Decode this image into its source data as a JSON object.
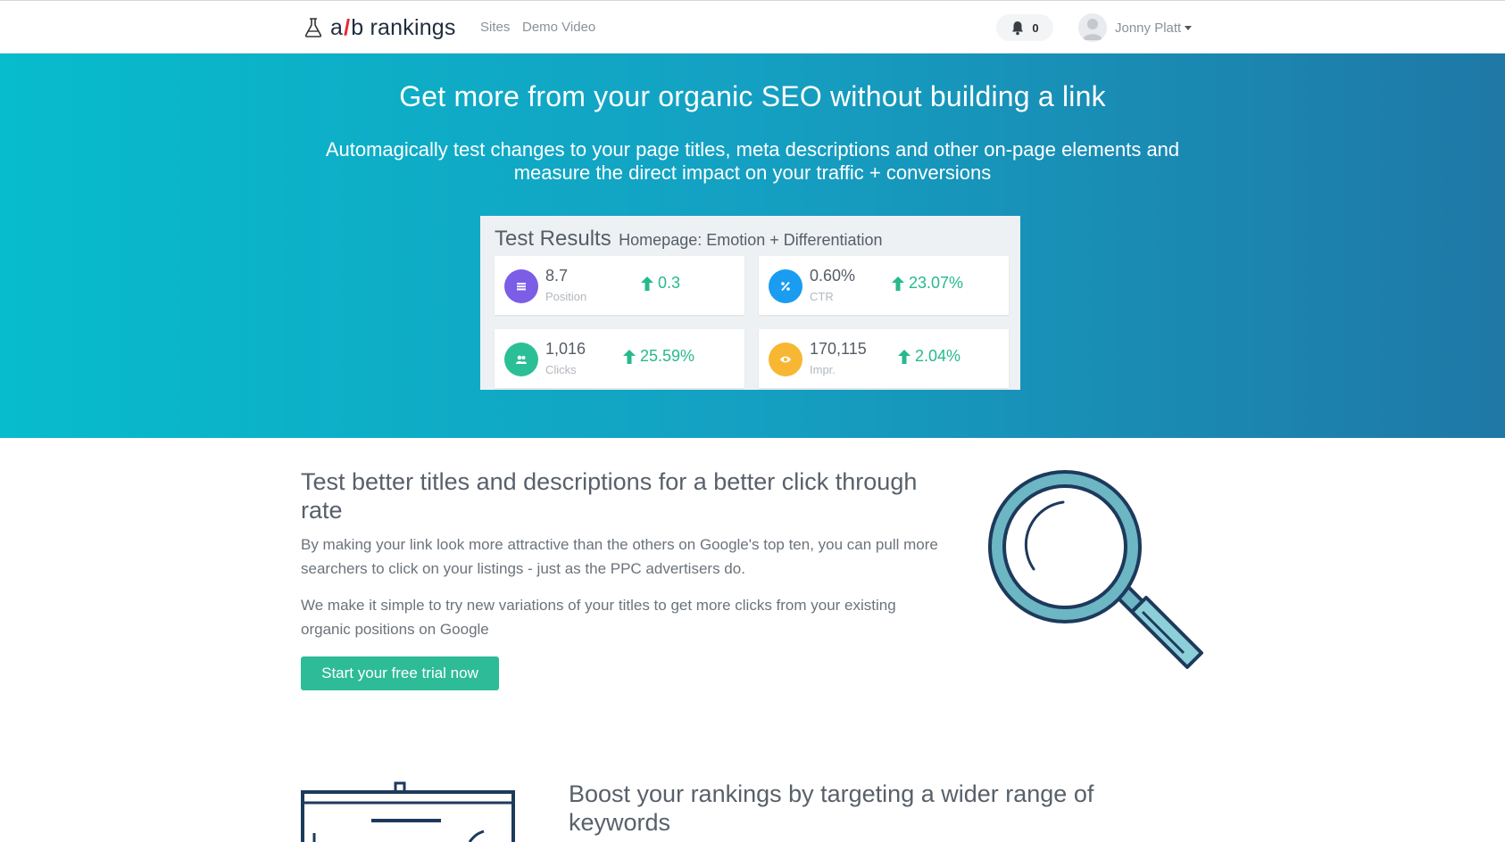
{
  "brand": {
    "prefix": "a",
    "slash": "/",
    "suffix": "b rankings"
  },
  "nav": {
    "sites": "Sites",
    "demo_video": "Demo Video"
  },
  "notifications": {
    "count": "0"
  },
  "user": {
    "name": "Jonny Platt"
  },
  "hero": {
    "title": "Get more from your organic SEO without building a link",
    "subtitle": "Automagically test changes to your page titles, meta descriptions and other on-page elements and measure the direct impact on your traffic + conversions"
  },
  "results": {
    "title": "Test Results",
    "subtitle": "Homepage: Emotion + Differentiation",
    "cards": [
      {
        "value": "8.7",
        "label": "Position",
        "delta": "0.3",
        "icon": "list-icon",
        "color": "#7b5de6"
      },
      {
        "value": "0.60%",
        "label": "CTR",
        "delta": "23.07%",
        "icon": "percent-icon",
        "color": "#1a9cf0"
      },
      {
        "value": "1,016",
        "label": "Clicks",
        "delta": "25.59%",
        "icon": "users-icon",
        "color": "#2bbf97"
      },
      {
        "value": "170,115",
        "label": "Impr.",
        "delta": "2.04%",
        "icon": "eye-icon",
        "color": "#f7b733"
      }
    ]
  },
  "section1": {
    "title": "Test better titles and descriptions for a better click through rate",
    "p1": "By making your link look more attractive than the others on Google's top ten, you can pull more searchers to click on your listings - just as the PPC advertisers do.",
    "p2": "We make it simple to try new variations of your titles to get more clicks from your existing organic positions on Google",
    "cta": "Start your free trial now"
  },
  "section2": {
    "title": "Boost your rankings by targeting a wider range of keywords"
  },
  "colors": {
    "accent": "#2ebb98",
    "hero_start": "#07bccc",
    "hero_end": "#1f78a6"
  }
}
